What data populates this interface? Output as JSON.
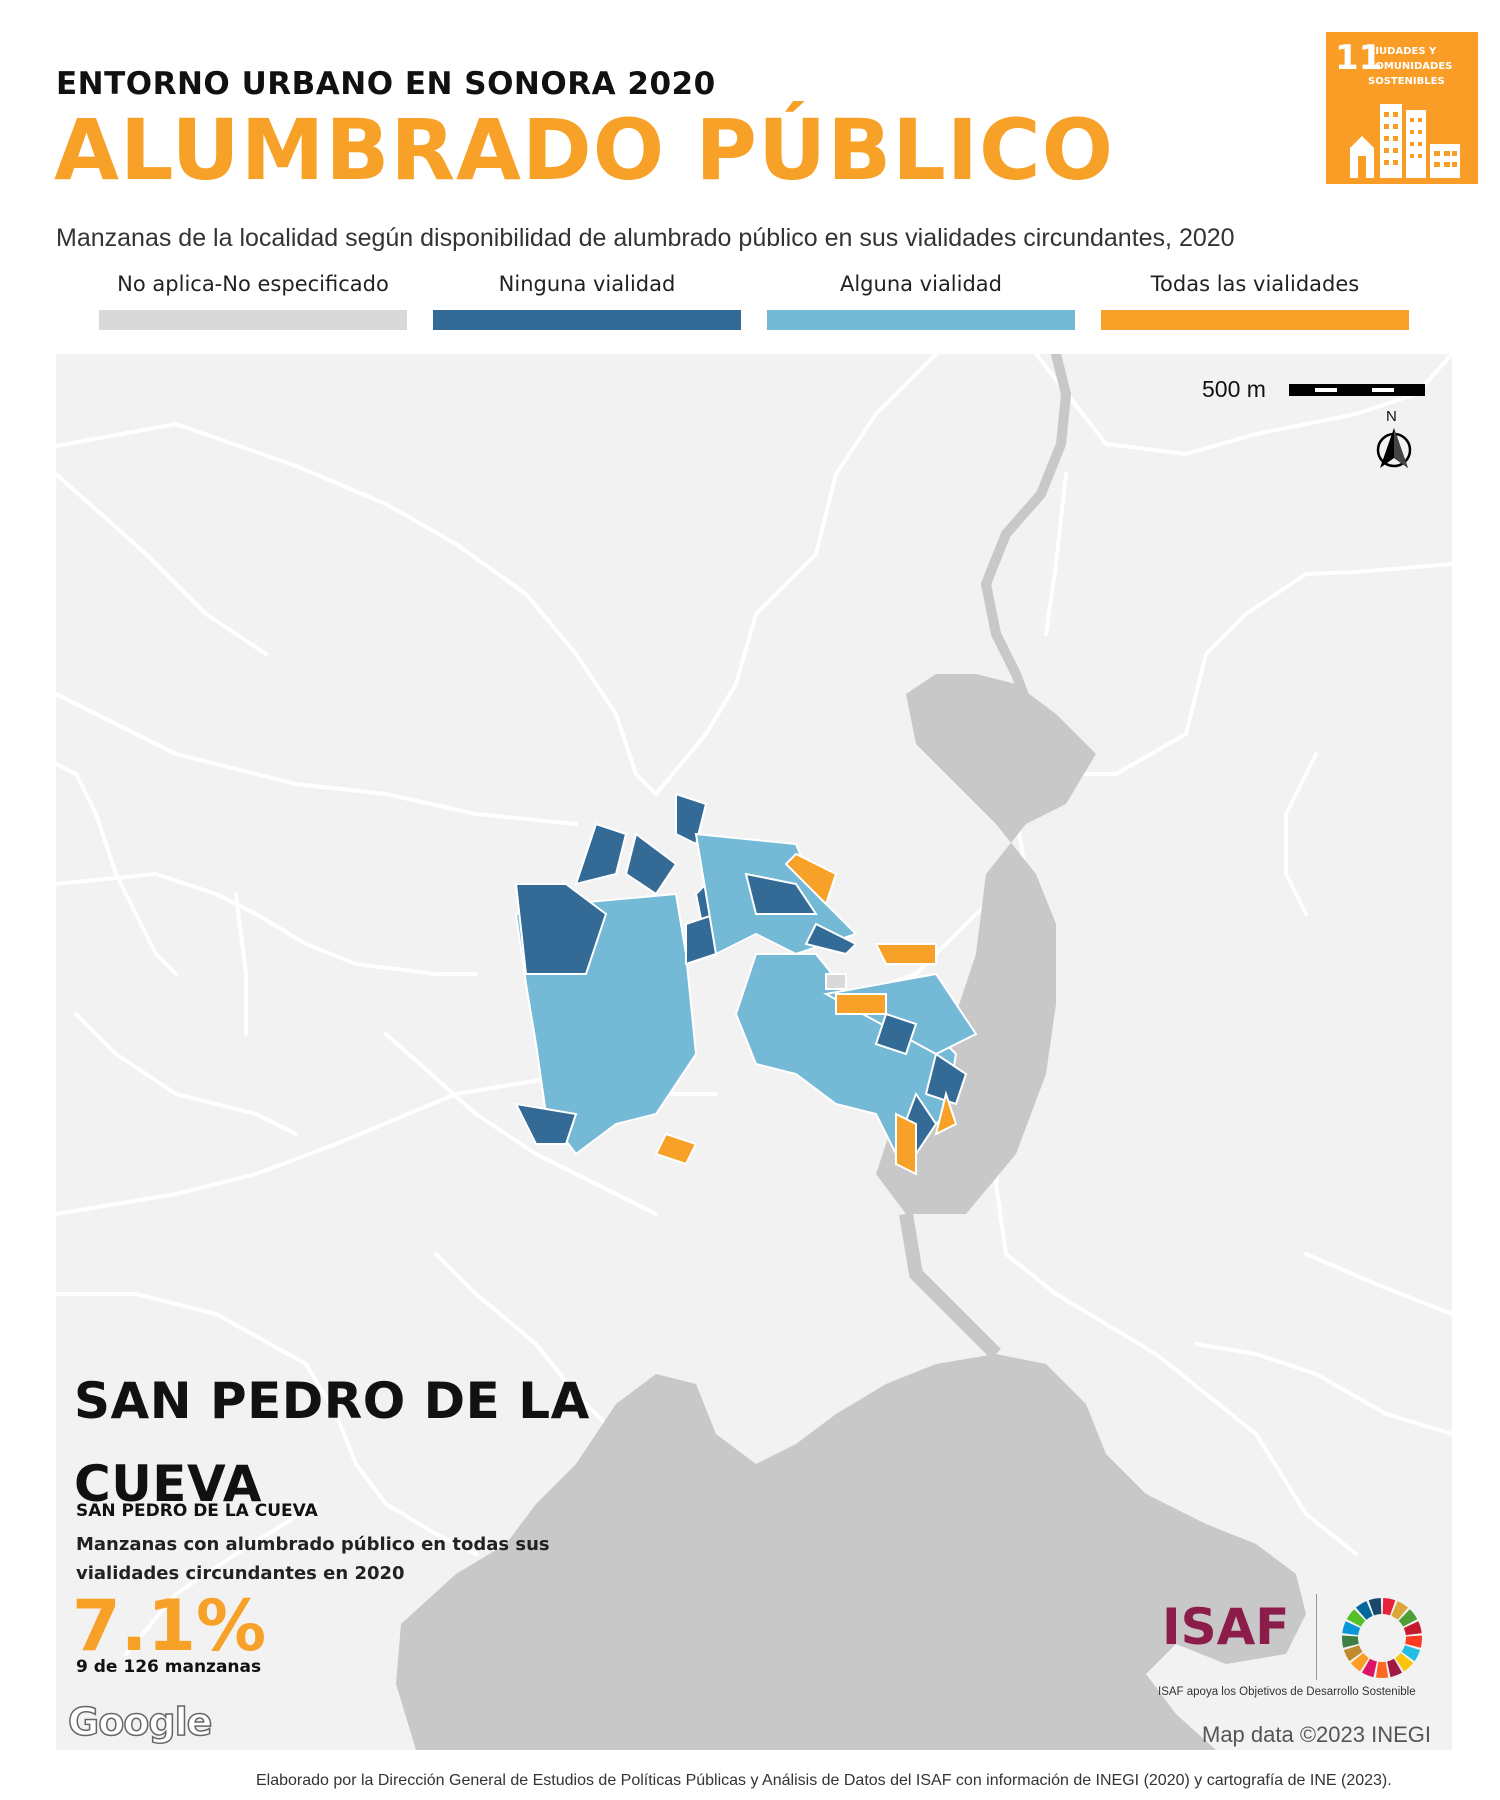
{
  "header": {
    "supertitle": "ENTORNO URBANO EN SONORA 2020",
    "title": "ALUMBRADO PÚBLICO",
    "subtitle": "Manzanas de la localidad según disponibilidad de alumbrado público en sus vialidades circundantes, 2020"
  },
  "sdg_badge": {
    "number": "11",
    "text": "CIUDADES Y COMUNIDADES SOSTENIBLES",
    "color": "#f99d26",
    "icon": "city-buildings-icon"
  },
  "legend": [
    {
      "label": "No aplica-No especificado",
      "color": "#d9d9d9"
    },
    {
      "label": "Ninguna vialidad",
      "color": "#336a96"
    },
    {
      "label": "Alguna vialidad",
      "color": "#74b9d6"
    },
    {
      "label": "Todas las vialidades",
      "color": "#f7a128"
    }
  ],
  "map": {
    "scale_label": "500 m",
    "north_label": "N",
    "attribution": "Map data ©2023 INEGI",
    "provider_logo": "Google"
  },
  "place": {
    "name": "SAN PEDRO DE LA CUEVA",
    "municipality": "SAN PEDRO DE LA CUEVA",
    "metric_label": "Manzanas con alumbrado público en todas sus vialidades circundantes en 2020",
    "metric_value": "7.1%",
    "metric_count": "9 de 126 manzanas"
  },
  "isaf": {
    "logo_text": "ISAF",
    "caption": "ISAF apoya los Objetivos de Desarrollo Sostenible"
  },
  "footer": {
    "credits": "Elaborado por la Dirección General de Estudios de Políticas Públicas y Análisis de Datos del ISAF con información de INEGI (2020) y cartografía de INE (2023)."
  }
}
